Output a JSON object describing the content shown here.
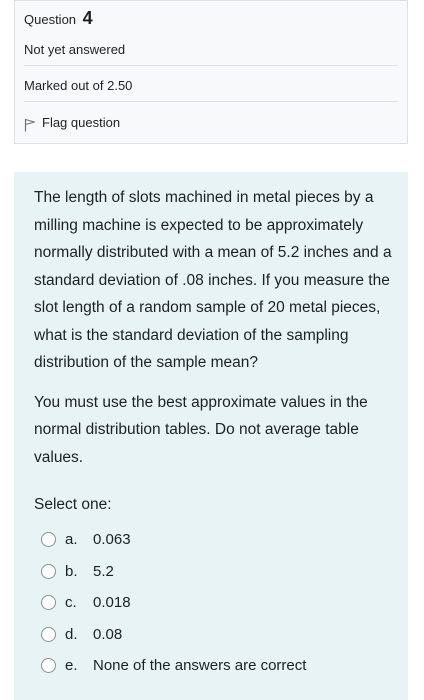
{
  "info": {
    "question_label": "Question",
    "question_number": "4",
    "state": "Not yet answered",
    "grade": "Marked out of 2.50",
    "flag_label": "Flag question",
    "flag_icon": "flag-icon"
  },
  "question": {
    "text": "The length of slots machined in metal pieces by a milling machine is expected to be approximately normally distributed with a mean of 5.2 inches and a standard deviation of .08 inches. If you measure the slot length of a random sample of 20 metal pieces, what is the standard deviation of the sampling distribution of the sample mean?",
    "instruction": "You must use the best approximate values in the normal distribution tables. Do not average table values.",
    "prompt": "Select one:",
    "options": [
      {
        "letter": "a.",
        "text": "0.063"
      },
      {
        "letter": "b.",
        "text": "5.2"
      },
      {
        "letter": "c.",
        "text": "0.018"
      },
      {
        "letter": "d.",
        "text": "0.08"
      },
      {
        "letter": "e.",
        "text": "None of the answers are correct"
      }
    ]
  },
  "colors": {
    "info_background": "#f8f9fa",
    "formulation_background": "#e7f3f5",
    "text": "#1d2125",
    "border": "#dee2e6"
  }
}
